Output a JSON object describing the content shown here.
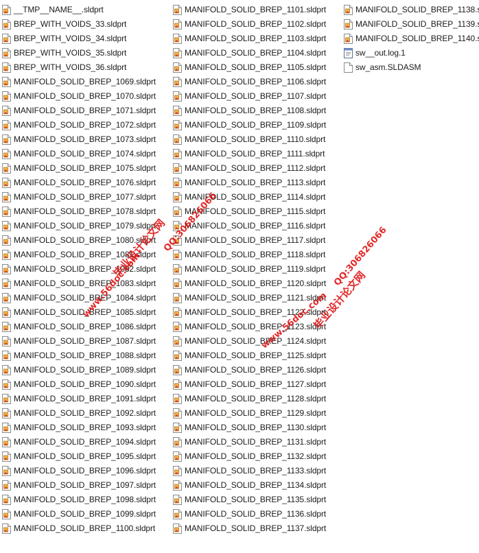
{
  "columns": [
    {
      "items": [
        {
          "name": "__TMP__NAME__.sldprt",
          "icon": "sldprt-file-icon"
        },
        {
          "name": "BREP_WITH_VOIDS_33.sldprt",
          "icon": "sldprt-file-icon"
        },
        {
          "name": "BREP_WITH_VOIDS_34.sldprt",
          "icon": "sldprt-file-icon"
        },
        {
          "name": "BREP_WITH_VOIDS_35.sldprt",
          "icon": "sldprt-file-icon"
        },
        {
          "name": "BREP_WITH_VOIDS_36.sldprt",
          "icon": "sldprt-file-icon"
        },
        {
          "name": "MANIFOLD_SOLID_BREP_1069.sldprt",
          "icon": "sldprt-file-icon"
        },
        {
          "name": "MANIFOLD_SOLID_BREP_1070.sldprt",
          "icon": "sldprt-file-icon"
        },
        {
          "name": "MANIFOLD_SOLID_BREP_1071.sldprt",
          "icon": "sldprt-file-icon"
        },
        {
          "name": "MANIFOLD_SOLID_BREP_1072.sldprt",
          "icon": "sldprt-file-icon"
        },
        {
          "name": "MANIFOLD_SOLID_BREP_1073.sldprt",
          "icon": "sldprt-file-icon"
        },
        {
          "name": "MANIFOLD_SOLID_BREP_1074.sldprt",
          "icon": "sldprt-file-icon"
        },
        {
          "name": "MANIFOLD_SOLID_BREP_1075.sldprt",
          "icon": "sldprt-file-icon"
        },
        {
          "name": "MANIFOLD_SOLID_BREP_1076.sldprt",
          "icon": "sldprt-file-icon"
        },
        {
          "name": "MANIFOLD_SOLID_BREP_1077.sldprt",
          "icon": "sldprt-file-icon"
        },
        {
          "name": "MANIFOLD_SOLID_BREP_1078.sldprt",
          "icon": "sldprt-file-icon"
        },
        {
          "name": "MANIFOLD_SOLID_BREP_1079.sldprt",
          "icon": "sldprt-file-icon"
        },
        {
          "name": "MANIFOLD_SOLID_BREP_1080.sldprt",
          "icon": "sldprt-file-icon"
        },
        {
          "name": "MANIFOLD_SOLID_BREP_1081.sldprt",
          "icon": "sldprt-file-icon"
        },
        {
          "name": "MANIFOLD_SOLID_BREP_1082.sldprt",
          "icon": "sldprt-file-icon"
        },
        {
          "name": "MANIFOLD_SOLID_BREP_1083.sldprt",
          "icon": "sldprt-file-icon"
        },
        {
          "name": "MANIFOLD_SOLID_BREP_1084.sldprt",
          "icon": "sldprt-file-icon"
        },
        {
          "name": "MANIFOLD_SOLID_BREP_1085.sldprt",
          "icon": "sldprt-file-icon"
        },
        {
          "name": "MANIFOLD_SOLID_BREP_1086.sldprt",
          "icon": "sldprt-file-icon"
        },
        {
          "name": "MANIFOLD_SOLID_BREP_1087.sldprt",
          "icon": "sldprt-file-icon"
        },
        {
          "name": "MANIFOLD_SOLID_BREP_1088.sldprt",
          "icon": "sldprt-file-icon"
        },
        {
          "name": "MANIFOLD_SOLID_BREP_1089.sldprt",
          "icon": "sldprt-file-icon"
        },
        {
          "name": "MANIFOLD_SOLID_BREP_1090.sldprt",
          "icon": "sldprt-file-icon"
        },
        {
          "name": "MANIFOLD_SOLID_BREP_1091.sldprt",
          "icon": "sldprt-file-icon"
        },
        {
          "name": "MANIFOLD_SOLID_BREP_1092.sldprt",
          "icon": "sldprt-file-icon"
        },
        {
          "name": "MANIFOLD_SOLID_BREP_1093.sldprt",
          "icon": "sldprt-file-icon"
        },
        {
          "name": "MANIFOLD_SOLID_BREP_1094.sldprt",
          "icon": "sldprt-file-icon"
        },
        {
          "name": "MANIFOLD_SOLID_BREP_1095.sldprt",
          "icon": "sldprt-file-icon"
        },
        {
          "name": "MANIFOLD_SOLID_BREP_1096.sldprt",
          "icon": "sldprt-file-icon"
        },
        {
          "name": "MANIFOLD_SOLID_BREP_1097.sldprt",
          "icon": "sldprt-file-icon"
        },
        {
          "name": "MANIFOLD_SOLID_BREP_1098.sldprt",
          "icon": "sldprt-file-icon"
        },
        {
          "name": "MANIFOLD_SOLID_BREP_1099.sldprt",
          "icon": "sldprt-file-icon"
        },
        {
          "name": "MANIFOLD_SOLID_BREP_1100.sldprt",
          "icon": "sldprt-file-icon"
        }
      ]
    },
    {
      "items": [
        {
          "name": "MANIFOLD_SOLID_BREP_1101.sldprt",
          "icon": "sldprt-file-icon"
        },
        {
          "name": "MANIFOLD_SOLID_BREP_1102.sldprt",
          "icon": "sldprt-file-icon"
        },
        {
          "name": "MANIFOLD_SOLID_BREP_1103.sldprt",
          "icon": "sldprt-file-icon"
        },
        {
          "name": "MANIFOLD_SOLID_BREP_1104.sldprt",
          "icon": "sldprt-file-icon"
        },
        {
          "name": "MANIFOLD_SOLID_BREP_1105.sldprt",
          "icon": "sldprt-file-icon"
        },
        {
          "name": "MANIFOLD_SOLID_BREP_1106.sldprt",
          "icon": "sldprt-file-icon"
        },
        {
          "name": "MANIFOLD_SOLID_BREP_1107.sldprt",
          "icon": "sldprt-file-icon"
        },
        {
          "name": "MANIFOLD_SOLID_BREP_1108.sldprt",
          "icon": "sldprt-file-icon"
        },
        {
          "name": "MANIFOLD_SOLID_BREP_1109.sldprt",
          "icon": "sldprt-file-icon"
        },
        {
          "name": "MANIFOLD_SOLID_BREP_1110.sldprt",
          "icon": "sldprt-file-icon"
        },
        {
          "name": "MANIFOLD_SOLID_BREP_1111.sldprt",
          "icon": "sldprt-file-icon"
        },
        {
          "name": "MANIFOLD_SOLID_BREP_1112.sldprt",
          "icon": "sldprt-file-icon"
        },
        {
          "name": "MANIFOLD_SOLID_BREP_1113.sldprt",
          "icon": "sldprt-file-icon"
        },
        {
          "name": "MANIFOLD_SOLID_BREP_1114.sldprt",
          "icon": "sldprt-file-icon"
        },
        {
          "name": "MANIFOLD_SOLID_BREP_1115.sldprt",
          "icon": "sldprt-file-icon"
        },
        {
          "name": "MANIFOLD_SOLID_BREP_1116.sldprt",
          "icon": "sldprt-file-icon"
        },
        {
          "name": "MANIFOLD_SOLID_BREP_1117.sldprt",
          "icon": "sldprt-file-icon"
        },
        {
          "name": "MANIFOLD_SOLID_BREP_1118.sldprt",
          "icon": "sldprt-file-icon"
        },
        {
          "name": "MANIFOLD_SOLID_BREP_1119.sldprt",
          "icon": "sldprt-file-icon"
        },
        {
          "name": "MANIFOLD_SOLID_BREP_1120.sldprt",
          "icon": "sldprt-file-icon"
        },
        {
          "name": "MANIFOLD_SOLID_BREP_1121.sldprt",
          "icon": "sldprt-file-icon"
        },
        {
          "name": "MANIFOLD_SOLID_BREP_1122.sldprt",
          "icon": "sldprt-file-icon"
        },
        {
          "name": "MANIFOLD_SOLID_BREP_1123.sldprt",
          "icon": "sldprt-file-icon"
        },
        {
          "name": "MANIFOLD_SOLID_BREP_1124.sldprt",
          "icon": "sldprt-file-icon"
        },
        {
          "name": "MANIFOLD_SOLID_BREP_1125.sldprt",
          "icon": "sldprt-file-icon"
        },
        {
          "name": "MANIFOLD_SOLID_BREP_1126.sldprt",
          "icon": "sldprt-file-icon"
        },
        {
          "name": "MANIFOLD_SOLID_BREP_1127.sldprt",
          "icon": "sldprt-file-icon"
        },
        {
          "name": "MANIFOLD_SOLID_BREP_1128.sldprt",
          "icon": "sldprt-file-icon"
        },
        {
          "name": "MANIFOLD_SOLID_BREP_1129.sldprt",
          "icon": "sldprt-file-icon"
        },
        {
          "name": "MANIFOLD_SOLID_BREP_1130.sldprt",
          "icon": "sldprt-file-icon"
        },
        {
          "name": "MANIFOLD_SOLID_BREP_1131.sldprt",
          "icon": "sldprt-file-icon"
        },
        {
          "name": "MANIFOLD_SOLID_BREP_1132.sldprt",
          "icon": "sldprt-file-icon"
        },
        {
          "name": "MANIFOLD_SOLID_BREP_1133.sldprt",
          "icon": "sldprt-file-icon"
        },
        {
          "name": "MANIFOLD_SOLID_BREP_1134.sldprt",
          "icon": "sldprt-file-icon"
        },
        {
          "name": "MANIFOLD_SOLID_BREP_1135.sldprt",
          "icon": "sldprt-file-icon"
        },
        {
          "name": "MANIFOLD_SOLID_BREP_1136.sldprt",
          "icon": "sldprt-file-icon"
        },
        {
          "name": "MANIFOLD_SOLID_BREP_1137.sldprt",
          "icon": "sldprt-file-icon"
        }
      ]
    },
    {
      "items": [
        {
          "name": "MANIFOLD_SOLID_BREP_1138.s",
          "icon": "sldprt-file-icon"
        },
        {
          "name": "MANIFOLD_SOLID_BREP_1139.s",
          "icon": "sldprt-file-icon"
        },
        {
          "name": "MANIFOLD_SOLID_BREP_1140.s",
          "icon": "sldprt-file-icon"
        },
        {
          "name": "sw__out.log.1",
          "icon": "log-file-icon"
        },
        {
          "name": "sw_asm.SLDASM",
          "icon": "blank-file-icon"
        }
      ]
    }
  ],
  "watermarks": [
    {
      "text": "毕业设计论文网"
    },
    {
      "text": "www.56doc.com"
    },
    {
      "text": "QQ:306826066"
    },
    {
      "text": "QQ:306826066"
    },
    {
      "text": "毕业设计论文网"
    },
    {
      "text": "www.56doc.com"
    }
  ],
  "colors": {
    "text": "#1a1a1a",
    "watermark": "#e01616",
    "hover": "#e5f3ff"
  }
}
